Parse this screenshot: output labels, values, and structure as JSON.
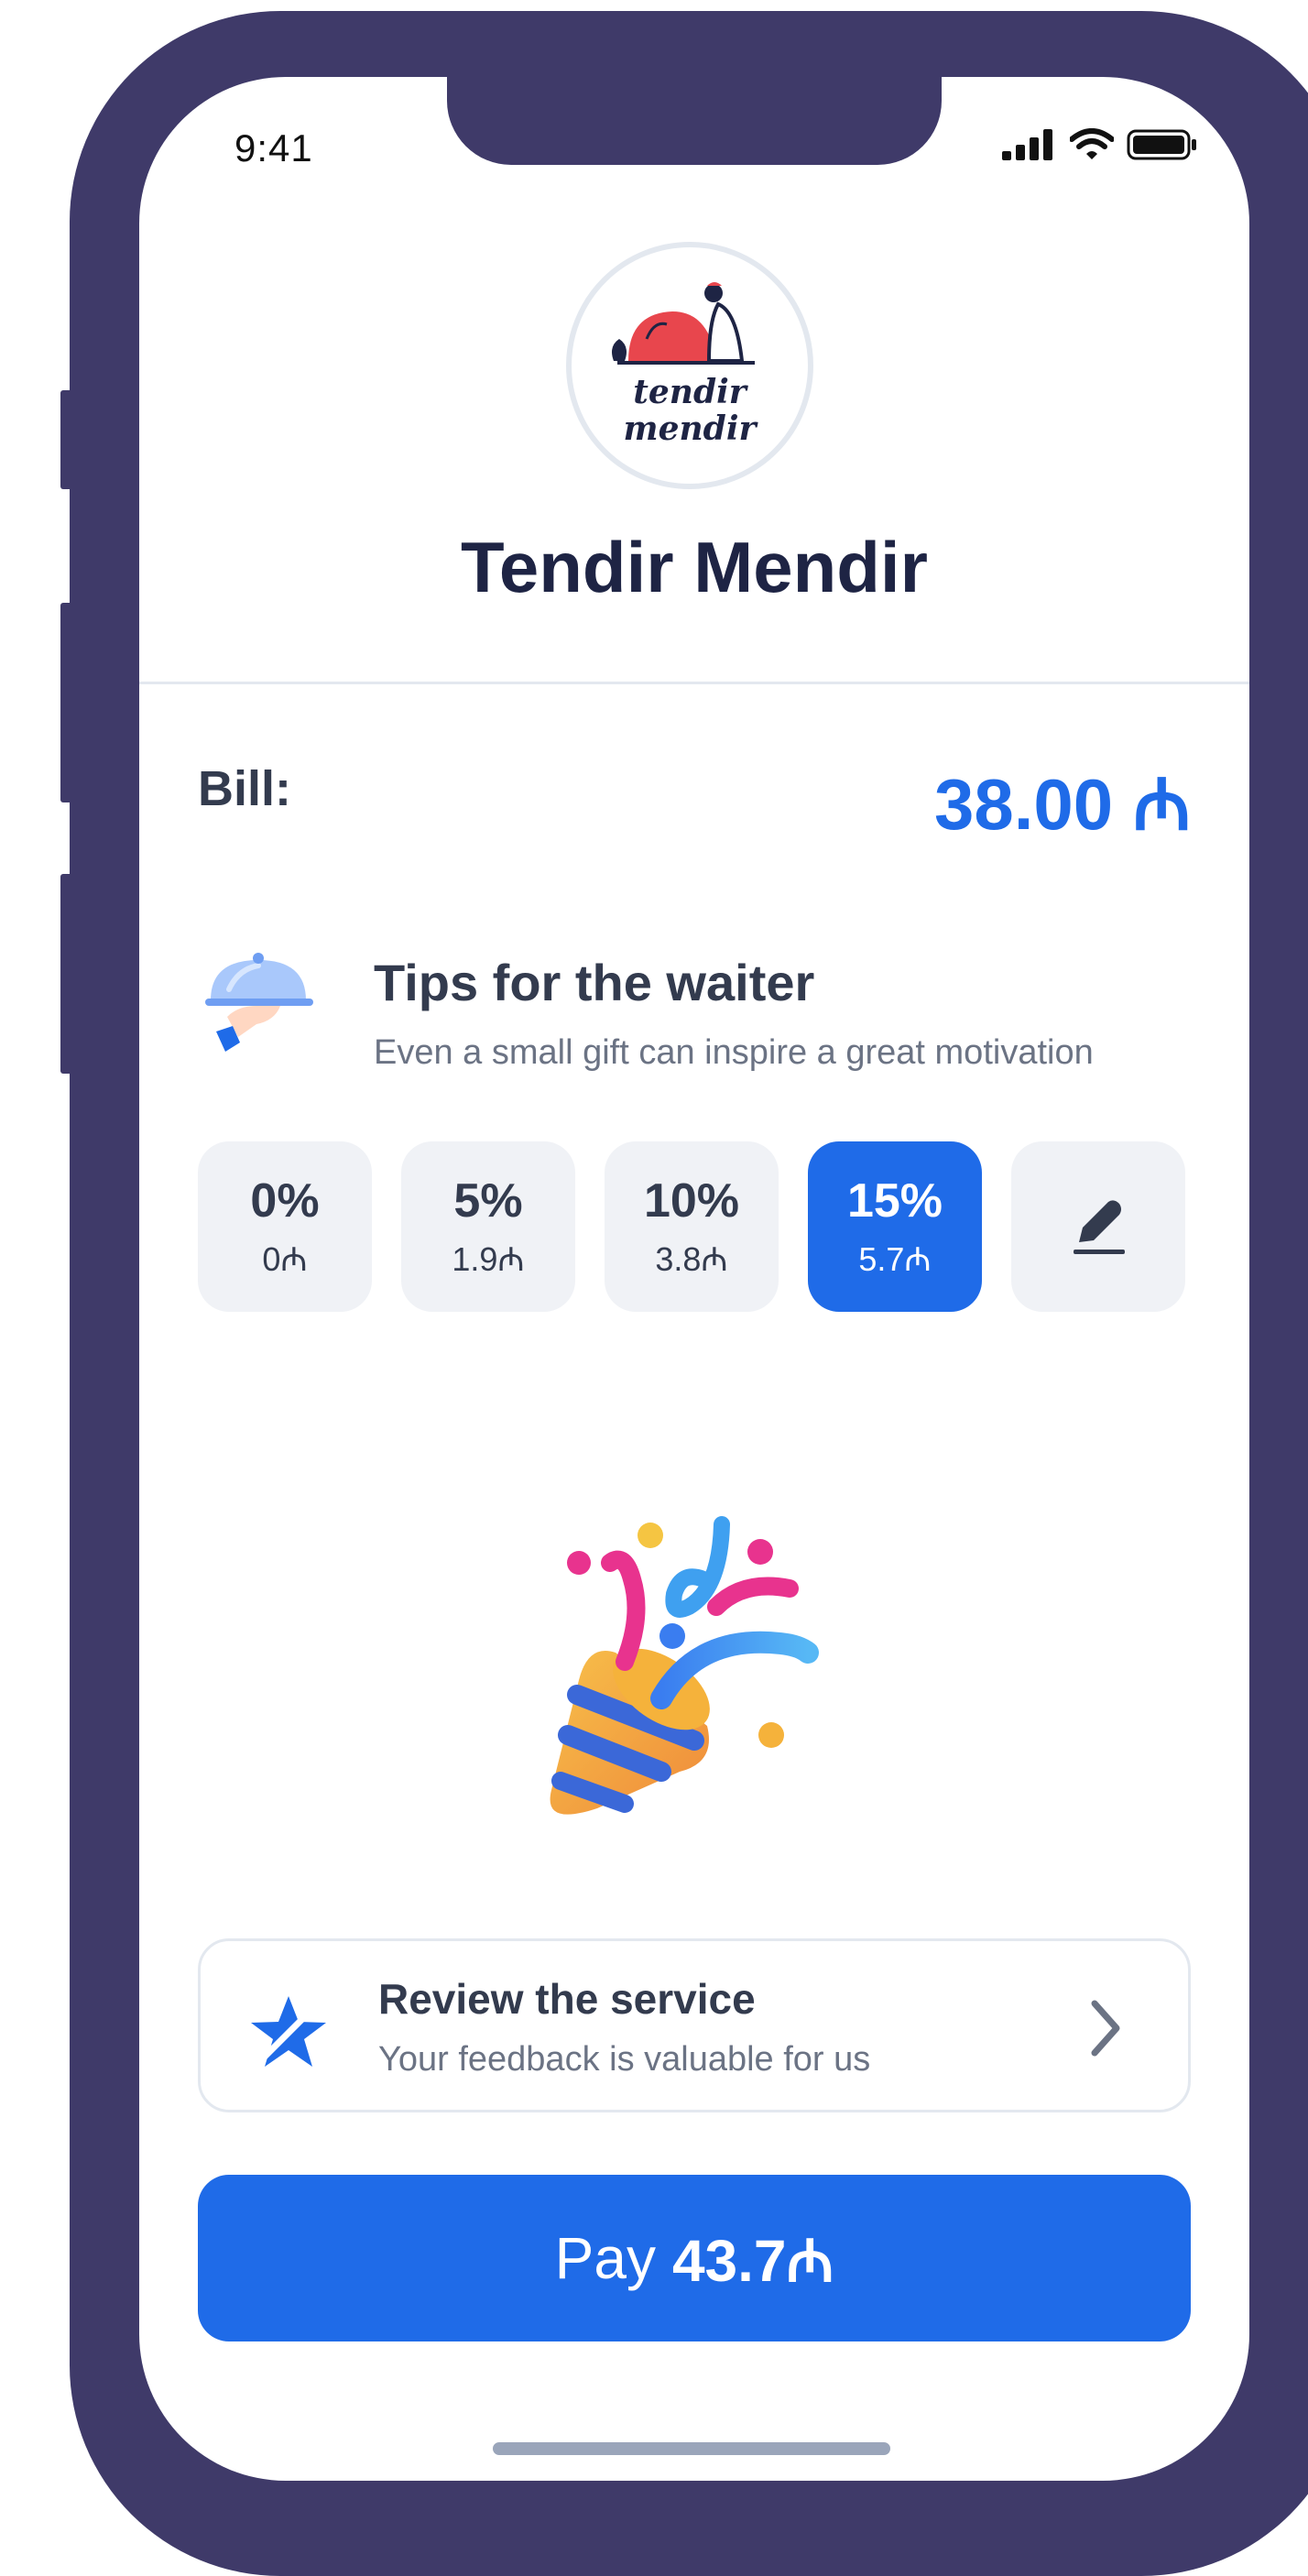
{
  "status_bar": {
    "time": "9:41",
    "icons": [
      "signal-icon",
      "wifi-icon",
      "battery-icon"
    ]
  },
  "restaurant": {
    "name": "Tendir Mendir",
    "logo_text": "tendir mendir"
  },
  "bill": {
    "label": "Bill:",
    "amount": "38.00 ₼"
  },
  "tips": {
    "title": "Tips for the waiter",
    "subtitle": "Even a small gift can inspire a great motivation",
    "options": [
      {
        "percent": "0%",
        "amount": "0₼",
        "selected": false
      },
      {
        "percent": "5%",
        "amount": "1.9₼",
        "selected": false
      },
      {
        "percent": "10%",
        "amount": "3.8₼",
        "selected": false
      },
      {
        "percent": "15%",
        "amount": "5.7₼",
        "selected": true
      }
    ],
    "custom_icon": "pencil-icon"
  },
  "review": {
    "title": "Review the service",
    "subtitle": "Your feedback is valuable for us"
  },
  "pay": {
    "label": "Pay",
    "amount": "43.7₼"
  },
  "colors": {
    "accent": "#1f6be8",
    "frame": "#3f3a69",
    "text": "#333b4e",
    "muted": "#6b7384"
  }
}
